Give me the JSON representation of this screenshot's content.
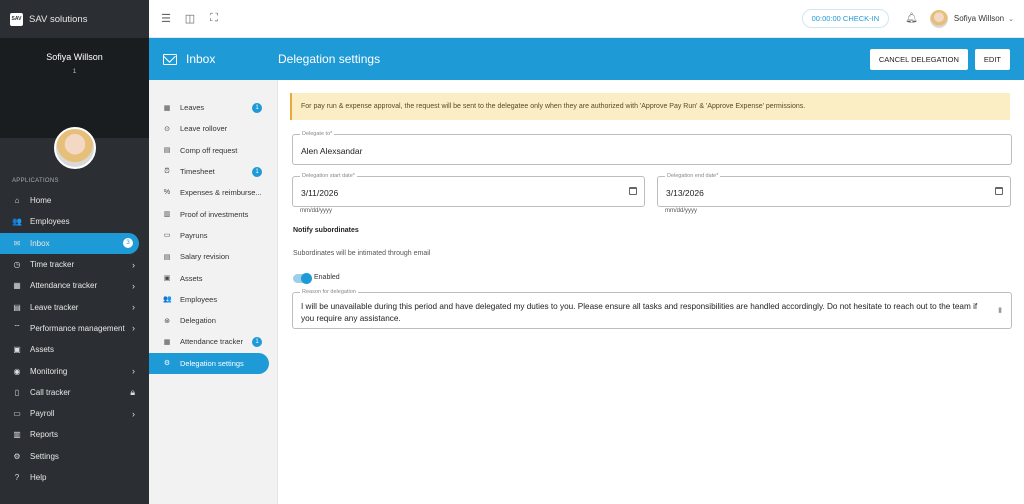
{
  "brand": {
    "logo_text": "SAV",
    "name": "SAV solutions"
  },
  "user": {
    "name": "Sofiya Willson",
    "sub": "1"
  },
  "sidebar": {
    "section_label": "APPLICATIONS",
    "items": [
      {
        "label": "Home",
        "icon": "home-icon"
      },
      {
        "label": "Employees",
        "icon": "people-icon"
      },
      {
        "label": "Inbox",
        "icon": "mail-icon",
        "badge": "3",
        "active": true
      },
      {
        "label": "Time tracker",
        "icon": "clock-icon",
        "chevron": true
      },
      {
        "label": "Attendance tracker",
        "icon": "calendar-icon",
        "chevron": true
      },
      {
        "label": "Leave tracker",
        "icon": "calendar-icon",
        "chevron": true
      },
      {
        "label": "Performance management",
        "icon": "signal-icon",
        "chevron": true
      },
      {
        "label": "Assets",
        "icon": "box-icon"
      },
      {
        "label": "Monitoring",
        "icon": "eye-icon",
        "chevron": true
      },
      {
        "label": "Call tracker",
        "icon": "phone-icon",
        "lock": true
      },
      {
        "label": "Payroll",
        "icon": "wallet-icon",
        "chevron": true
      },
      {
        "label": "Reports",
        "icon": "report-icon"
      },
      {
        "label": "Settings",
        "icon": "gear-icon"
      },
      {
        "label": "Help",
        "icon": "help-icon"
      }
    ]
  },
  "topbar": {
    "checkin": "00:00:00 CHECK-IN",
    "user_name": "Sofiya Willson"
  },
  "header": {
    "section": "Inbox",
    "title": "Delegation settings",
    "cancel_label": "CANCEL DELEGATION",
    "edit_label": "EDIT"
  },
  "submenu": [
    {
      "label": "Leaves",
      "badge": "1"
    },
    {
      "label": "Leave rollover"
    },
    {
      "label": "Comp off request"
    },
    {
      "label": "Timesheet",
      "badge": "1"
    },
    {
      "label": "Expenses & reimburse..."
    },
    {
      "label": "Proof of investments"
    },
    {
      "label": "Payruns"
    },
    {
      "label": "Salary revision"
    },
    {
      "label": "Assets"
    },
    {
      "label": "Employees"
    },
    {
      "label": "Delegation"
    },
    {
      "label": "Attendance tracker",
      "badge": "1"
    },
    {
      "label": "Delegation settings",
      "active": true
    }
  ],
  "form": {
    "notice": "For pay run & expense approval, the request will be sent to the delegatee only when they are authorized with 'Approve Pay Run' & 'Approve Expense' permissions.",
    "delegate_label": "Delegate to*",
    "delegate_value": "Alen Alexsandar",
    "start_label": "Delegation start date*",
    "start_value": "3/11/2026",
    "start_helper": "mm/dd/yyyy",
    "end_label": "Delegation end date*",
    "end_value": "3/13/2026",
    "end_helper": "mm/dd/yyyy",
    "notify_title": "Notify subordinates",
    "notify_desc": "Subordinates will be intimated through email",
    "toggle_label": "Enabled",
    "toggle_on": true,
    "reason_label": "Reason for delegation",
    "reason_value": "I will be unavailable during this period and have delegated my duties to you. Please ensure all tasks and responsibilities are handled accordingly. Do not hesitate to reach out to the team if you require any assistance."
  },
  "colors": {
    "accent": "#1e9ad6",
    "sidebar": "#2b2f33",
    "notice_bg": "#fbeec4"
  }
}
